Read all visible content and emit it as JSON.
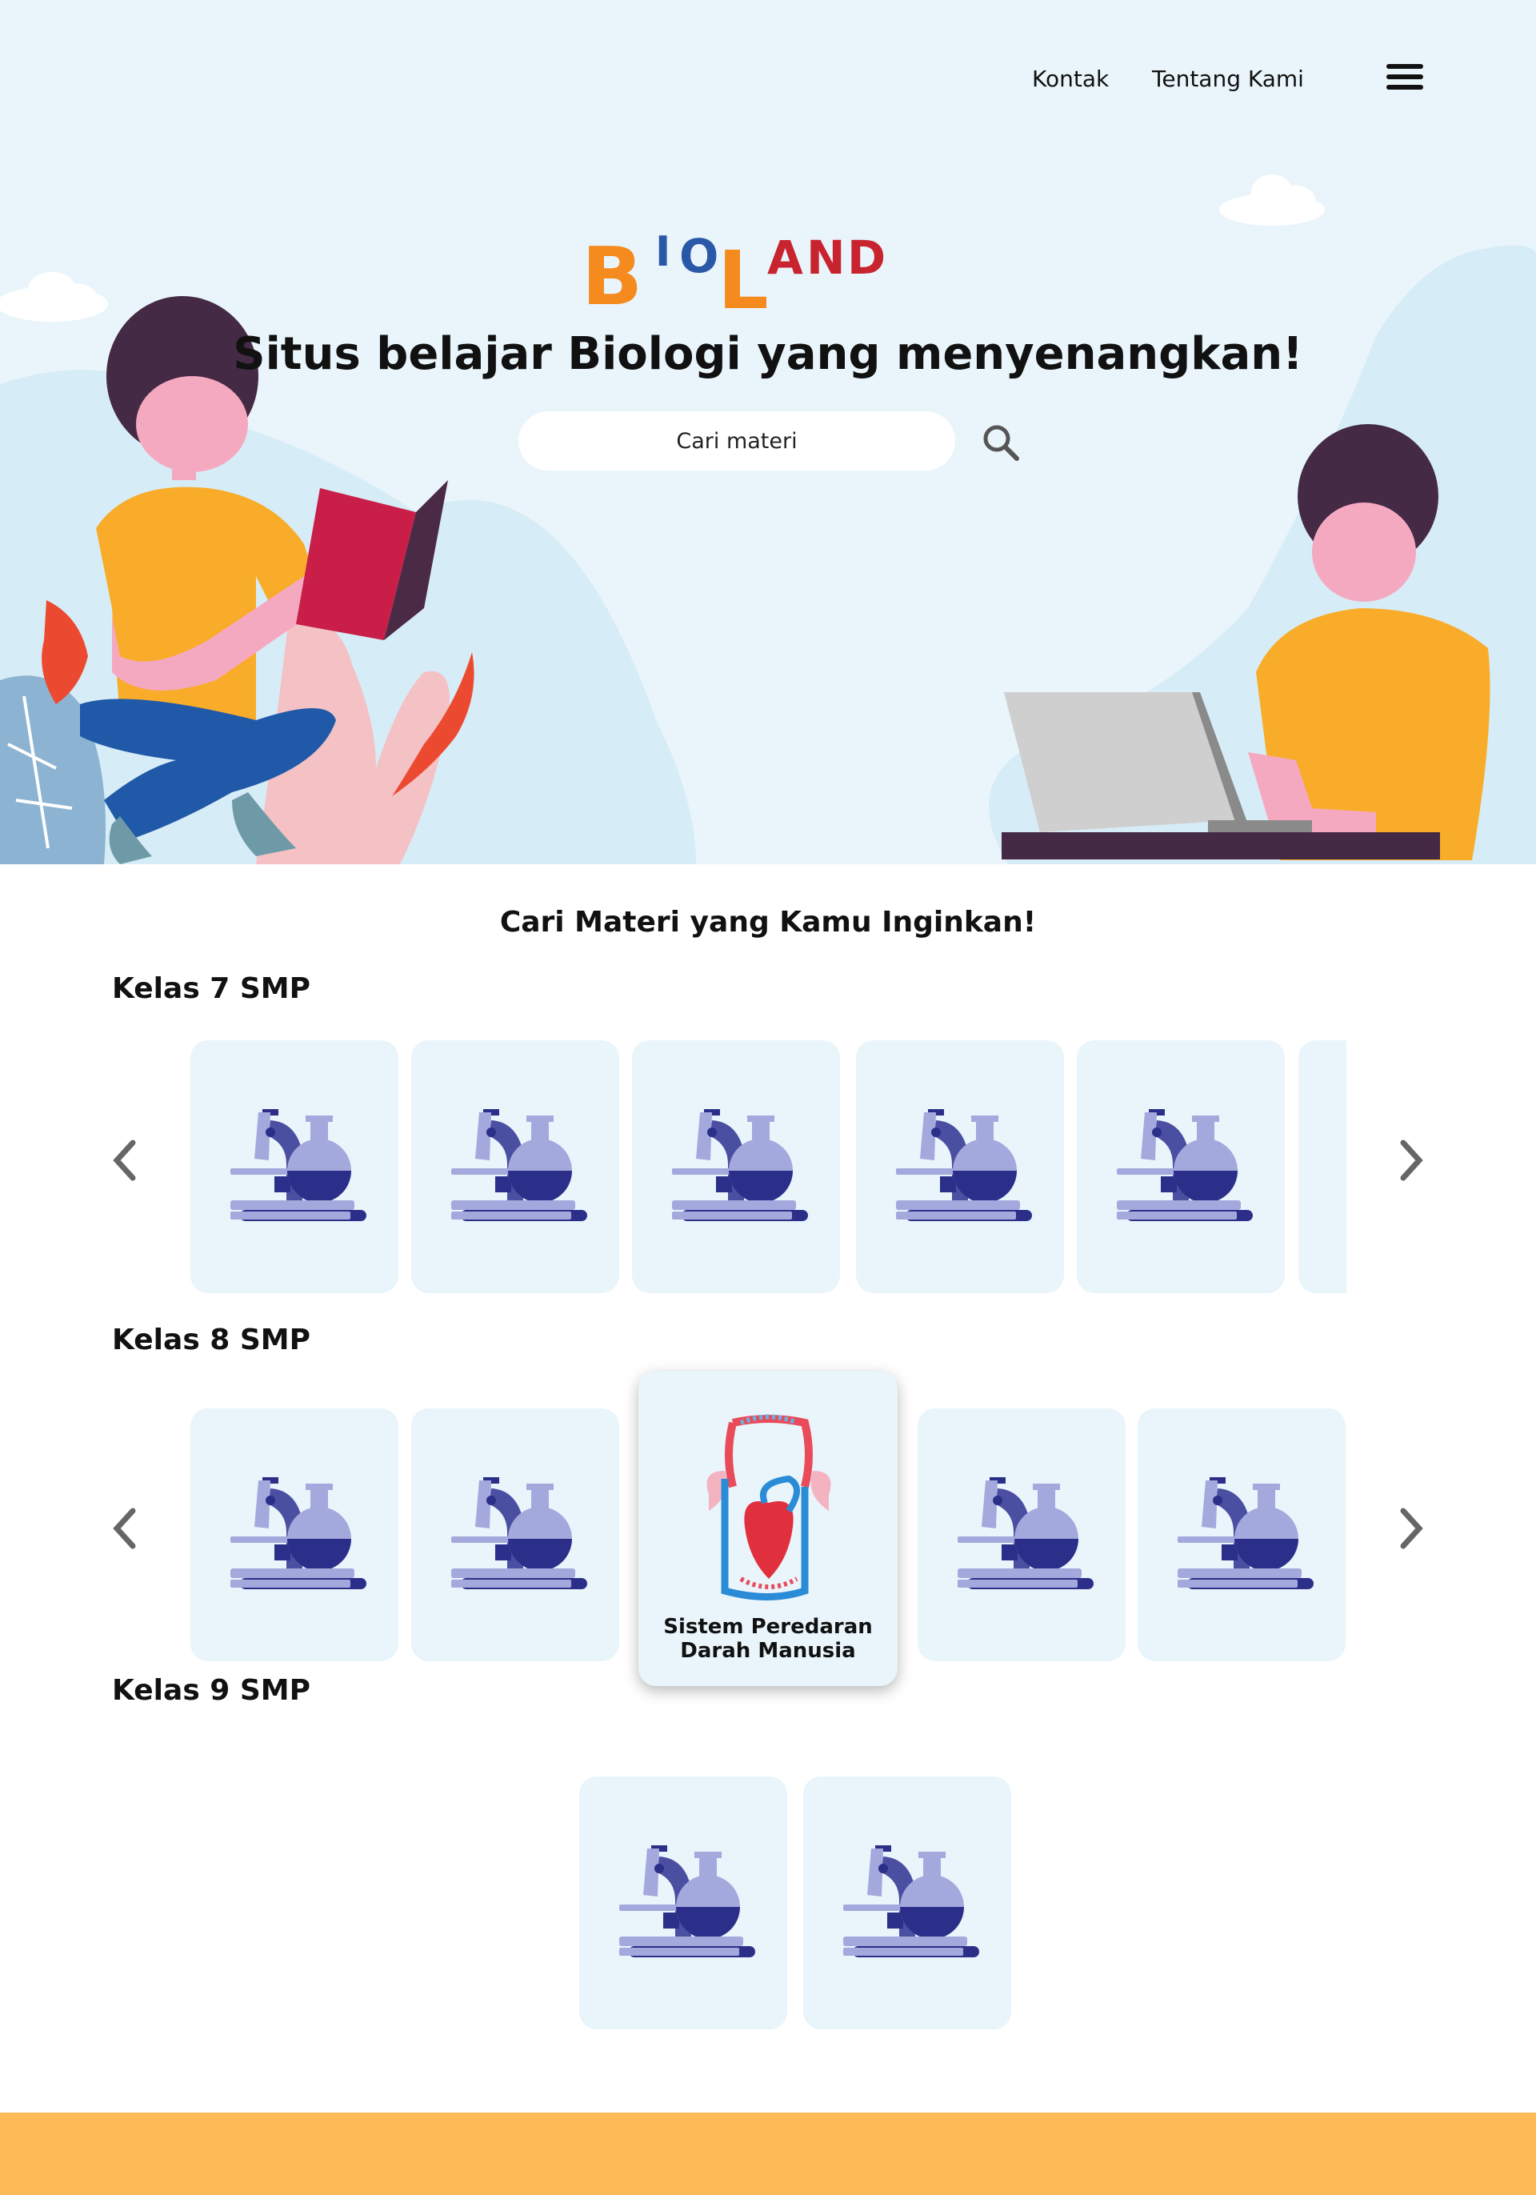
{
  "nav": {
    "kontak": "Kontak",
    "tentang": "Tentang Kami",
    "menu_icon": "hamburger-menu-icon"
  },
  "logo": {
    "letters": [
      "B",
      "I",
      "O",
      "L",
      "A",
      "N",
      "D"
    ],
    "colors": [
      "#f58a1f",
      "#2a58a8",
      "#2a58a8",
      "#f58a1f",
      "#c8242f",
      "#c8242f",
      "#c8242f"
    ]
  },
  "hero": {
    "title": "Situs belajar Biologi yang menyenangkan!",
    "search_placeholder": "Cari materi",
    "search_icon": "search-icon"
  },
  "main": {
    "title": "Cari Materi yang Kamu Inginkan!",
    "kelas7": {
      "title": "Kelas 7 SMP"
    },
    "kelas8": {
      "title": "Kelas 8 SMP",
      "featured_label_line1": "Sistem Peredaran",
      "featured_label_line2": "Darah Manusia"
    },
    "kelas9": {
      "title": "Kelas 9 SMP"
    }
  },
  "colors": {
    "hero_bg": "#e9f5fb",
    "card_bg": "#e9f5fb",
    "footer": "#ffbb55",
    "lab_icon_light": "#a4a9dd",
    "lab_icon_dark": "#2c2f8a"
  }
}
